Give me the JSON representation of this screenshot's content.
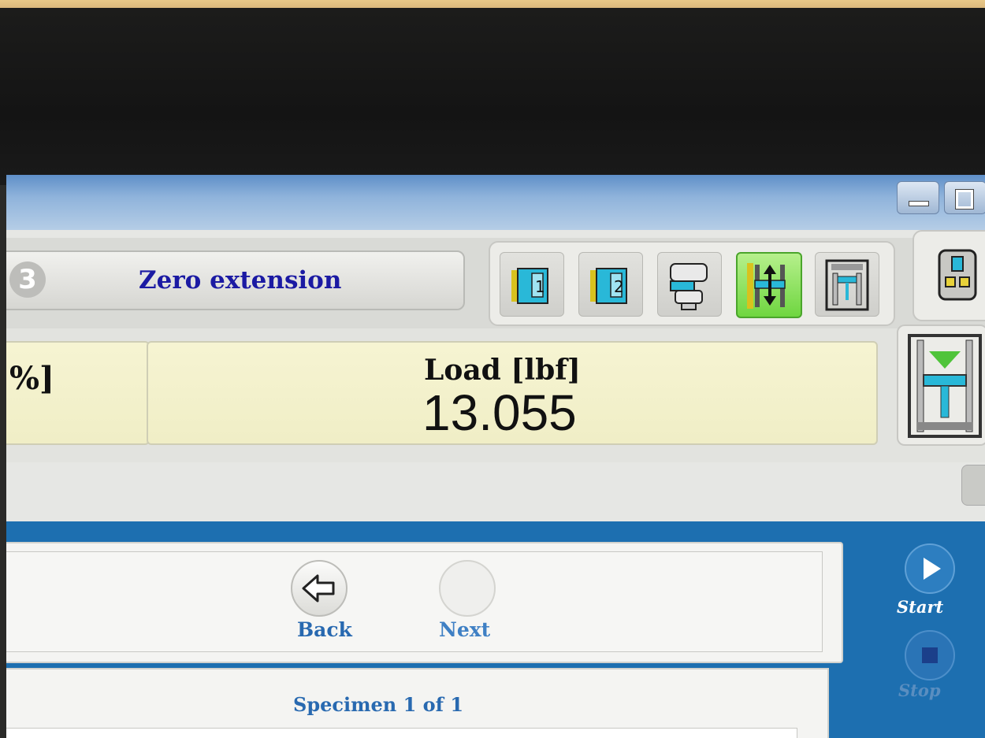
{
  "step": {
    "number": "3",
    "label": "Zero extension"
  },
  "toolbar": {
    "icons": [
      "transducer-1-icon",
      "transducer-2-icon",
      "grip-icon",
      "crosshead-move-icon",
      "frame-icon"
    ],
    "active": "crosshead-move-icon",
    "extra_icon": "control-panel-icon",
    "active_color": "#6fd640"
  },
  "readouts": {
    "left_unit": "%]",
    "load_label": "Load [lbf]",
    "load_value": "13.055"
  },
  "navigation": {
    "back_label": "Back",
    "next_label": "Next"
  },
  "specimen": {
    "label": "Specimen 1 of 1"
  },
  "sidebar": {
    "start_label": "Start",
    "stop_label": "Stop"
  },
  "colors": {
    "step_label": "#1b1aa3",
    "panel_blue": "#1d6fb0",
    "nav_text": "#2869b0",
    "readout_bg": "#f4f2cc"
  }
}
